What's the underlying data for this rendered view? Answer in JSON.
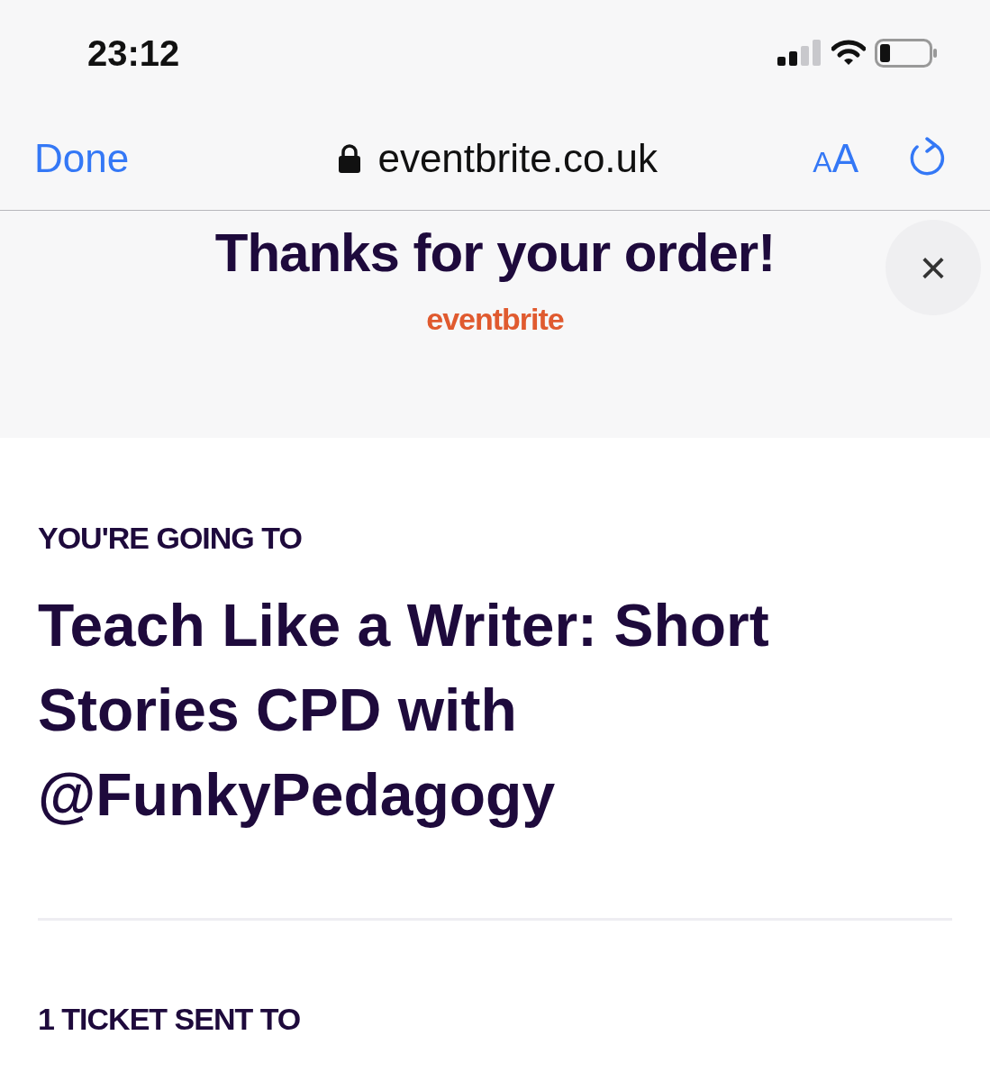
{
  "status_bar": {
    "time": "23:12"
  },
  "browser_bar": {
    "done": "Done",
    "secure": true,
    "url": "eventbrite.co.uk",
    "text_size_small": "A",
    "text_size_large": "A"
  },
  "header": {
    "title": "Thanks for your order!",
    "logo": "eventbrite",
    "close": "×"
  },
  "event": {
    "eyebrow": "YOU'RE GOING TO",
    "title": "Teach Like a Writer: Short Stories CPD with @FunkyPedagogy"
  },
  "tickets": {
    "heading": "1 TICKET SENT TO"
  }
}
